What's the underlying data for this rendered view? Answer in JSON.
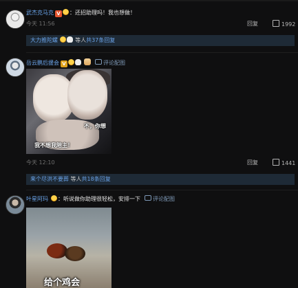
{
  "comments": [
    {
      "username": "武杰克马克",
      "badge": "V",
      "text": "：还招助理吗！我也想做！",
      "time": "今天 11:56",
      "reply_label": "回复",
      "likes": "1992",
      "replies": {
        "name": "大力推陀螺",
        "mid": "等人",
        "count": "共37条回复"
      }
    },
    {
      "username": "岳云鹏后援会",
      "badge": "V",
      "reply_link": "评论配图",
      "image_caption_1": "不，你想",
      "image_caption_2": "我不想我陪主！",
      "time": "今天 12:10",
      "reply_label": "回复",
      "likes": "1441",
      "replies": {
        "name": "来个尽洪不要葬",
        "mid": "等人",
        "count": "共18条回复"
      }
    },
    {
      "username": "叶星阿玛",
      "text": "：听说做你助理很轻松，安排一下",
      "reply_link": "评论配图",
      "image_caption": "给个鸡会"
    }
  ]
}
